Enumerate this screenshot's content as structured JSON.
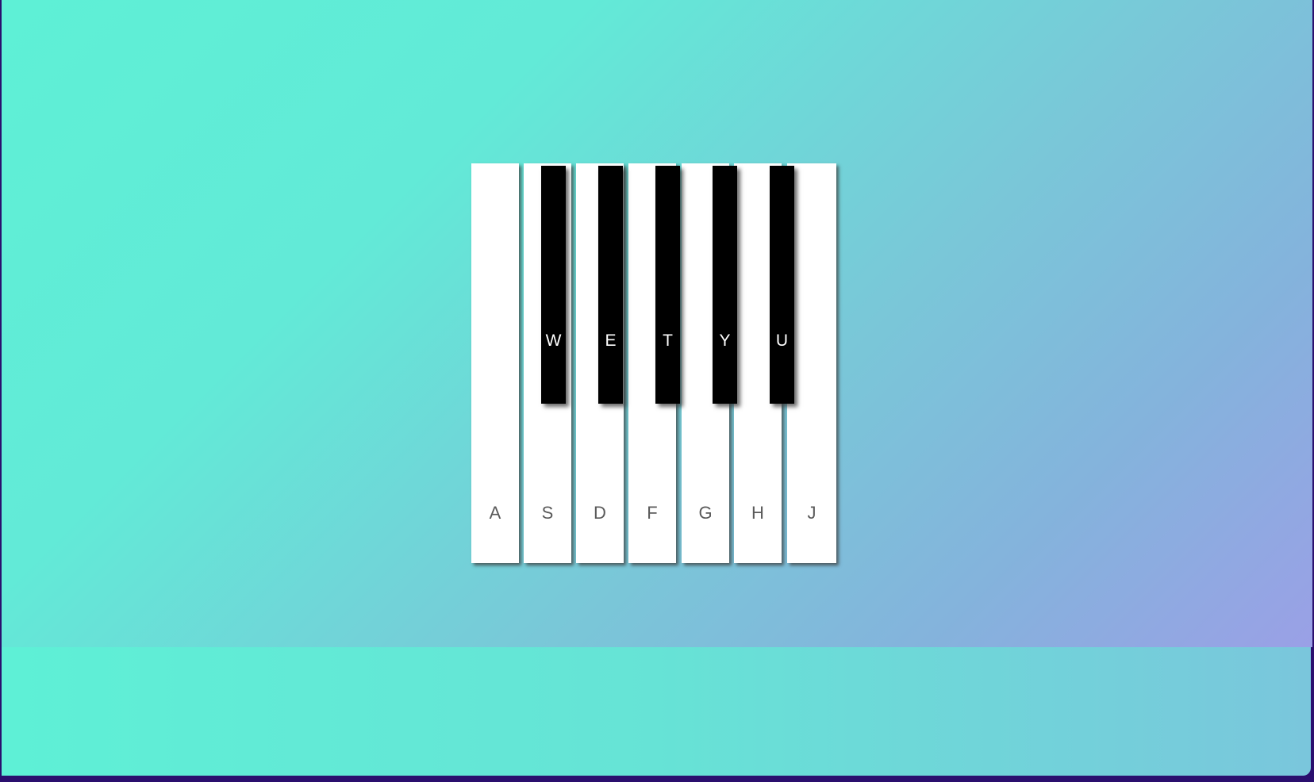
{
  "piano": {
    "white_keys": [
      {
        "label": "A"
      },
      {
        "label": "S"
      },
      {
        "label": "D"
      },
      {
        "label": "F"
      },
      {
        "label": "G"
      },
      {
        "label": "H"
      },
      {
        "label": "J"
      }
    ],
    "black_keys": [
      {
        "label": "W"
      },
      {
        "label": "E"
      },
      {
        "label": "T"
      },
      {
        "label": "Y"
      },
      {
        "label": "U"
      }
    ]
  },
  "colors": {
    "gradient_start": "#5ef0d6",
    "gradient_end": "#9aa0e6",
    "white_key": "#ffffff",
    "black_key": "#000000",
    "footer_strip": "#2a0f6e"
  }
}
